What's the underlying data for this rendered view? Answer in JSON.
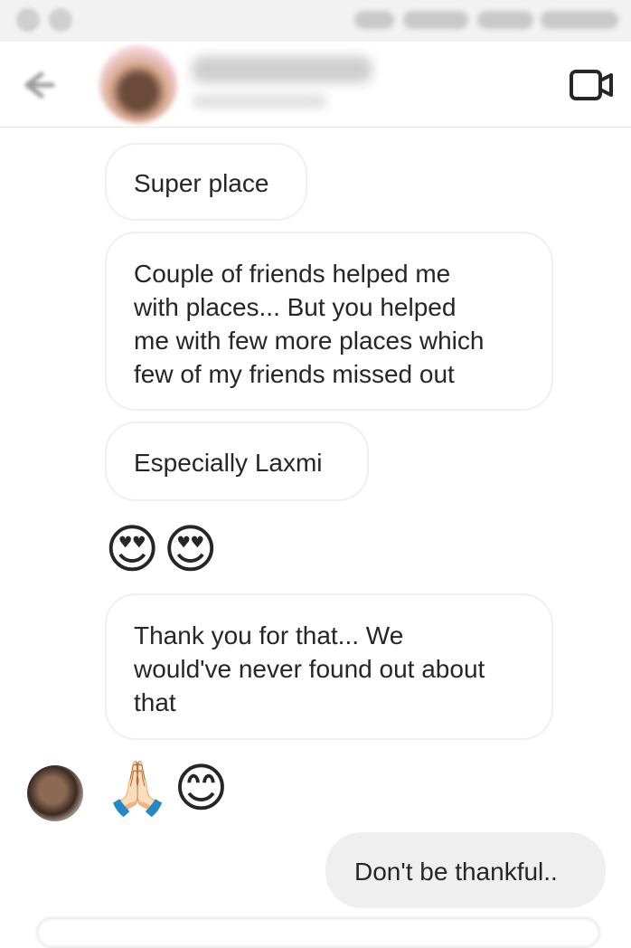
{
  "messages": {
    "m1": "Super place",
    "m2": "Couple of friends helped me\nwith places... But you helped\nme with few more places which\nfew of my friends missed out",
    "m3": "Especially Laxmi",
    "emoji_row_1": "😍😍",
    "m4": "Thank you for that... We\nwould've never found out about\nthat",
    "emoji_row_2": "🙏🏻😊",
    "sent_1": "Don't be thankful.."
  },
  "icons": {
    "back": "arrow-left-icon",
    "video": "video-camera-icon"
  },
  "colors": {
    "background": "#ffffff",
    "bubble_border": "#efefef",
    "sent_bubble": "#efefef",
    "text": "#262626"
  }
}
